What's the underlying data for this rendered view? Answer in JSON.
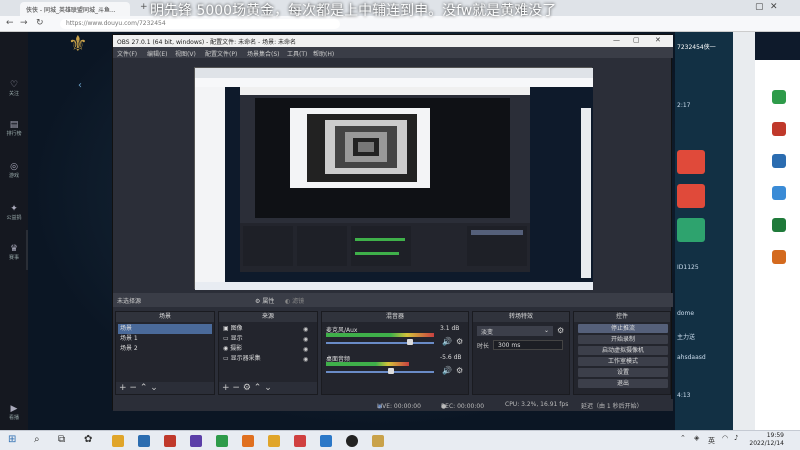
{
  "browser": {
    "tabs": [
      {
        "label": "侠侠 - 同城_英雄联盟同城_斗鱼..."
      },
      {
        "label": "+"
      }
    ],
    "url": "https://www.douyu.com/7232454",
    "danmaku": "明先锋 5000场黄金，每次都是上中辅连到申。没fw就是黄难没了"
  },
  "sidebar": {
    "items": [
      {
        "icon": "heart-icon",
        "label": "关注"
      },
      {
        "icon": "ranking-icon",
        "label": "排行榜"
      },
      {
        "icon": "gamepad-icon",
        "label": "游戏"
      },
      {
        "icon": "reward-icon",
        "label": "公益捐"
      },
      {
        "icon": "trophy-icon",
        "label": "赛事"
      },
      {
        "icon": "live-icon",
        "label": "看播"
      }
    ]
  },
  "chat": {
    "room_id": "7232454侠一",
    "time": "2:17",
    "lines": [
      "ID1125",
      "dome",
      "主力送",
      "ahsdaasd",
      "4:13"
    ]
  },
  "obs": {
    "title": "OBS 27.0.1 (64 bit, windows) - 配置文件: 未命名 - 场景: 未命名",
    "menu": [
      "文件(F)",
      "编辑(E)",
      "视图(V)",
      "配置文件(P)",
      "场景集合(S)",
      "工具(T)",
      "帮助(H)"
    ],
    "no_source": "未选择源",
    "props_label": "属性",
    "filters_label": "滤镜",
    "docks": {
      "scenes": {
        "header": "场景",
        "items": [
          "场景",
          "场景 1",
          "场景 2"
        ]
      },
      "sources": {
        "header": "来源",
        "items": [
          "图像",
          "显示",
          "摄影",
          "显示器采集"
        ]
      },
      "mixer": {
        "header": "混音器",
        "channels": [
          {
            "name": "麦克风/Aux",
            "db": "3.1 dB",
            "level": 0.78
          },
          {
            "name": "桌面音频",
            "db": "-5.6 dB",
            "level": 0.6
          }
        ]
      },
      "transitions": {
        "header": "转场特效",
        "type": "淡变",
        "duration_label": "时长",
        "duration": "300 ms"
      },
      "controls": {
        "header": "控件",
        "buttons": [
          "停止推流",
          "开始录制",
          "启动虚拟摄像机",
          "工作室模式",
          "设置",
          "退出"
        ]
      }
    },
    "status": {
      "live": "LIVE: 00:00:00",
      "rec": "REC: 00:00:00",
      "cpu": "CPU: 3.2%, 16.91 fps",
      "delay": "延迟（由 1 秒后开始）"
    }
  },
  "taskbar": {
    "time": "19:59",
    "date": "2022/12/14",
    "lang": "英"
  }
}
